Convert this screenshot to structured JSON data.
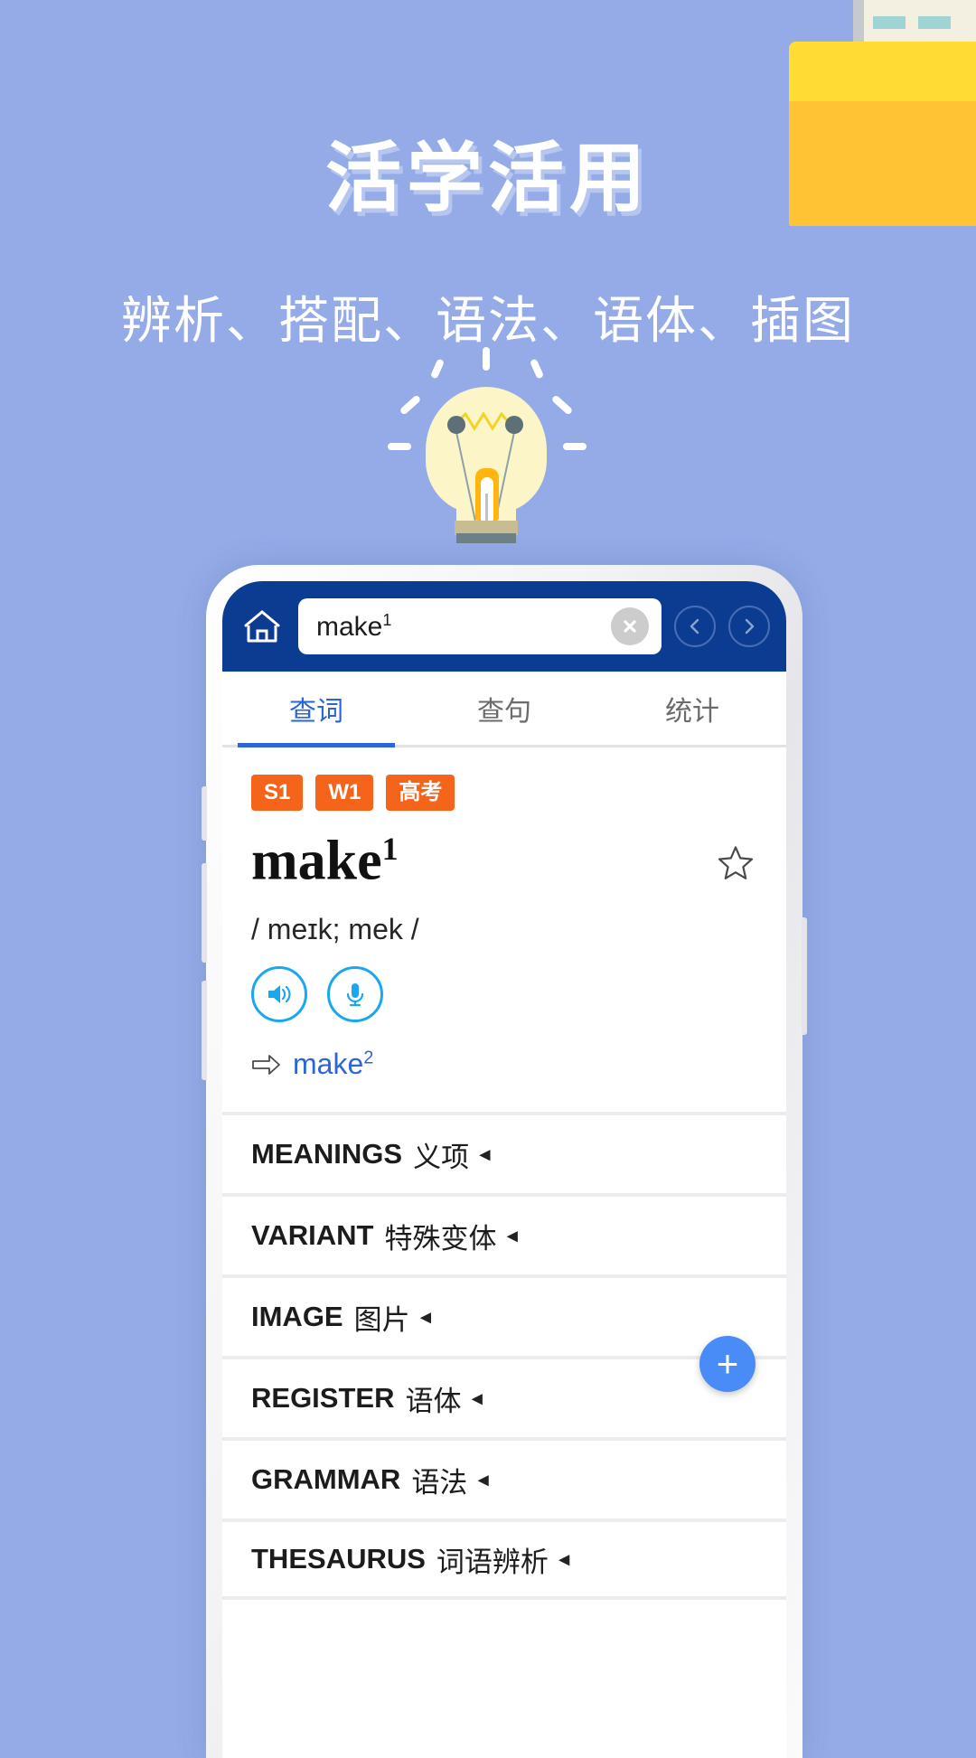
{
  "hero": {
    "title": "活学活用",
    "subtitle": "辨析、搭配、语法、语体、插图"
  },
  "colors": {
    "background": "#94abe8",
    "app_header": "#0c3c91",
    "accent_blue": "#2b66d9",
    "badge_orange": "#f4651b",
    "audio_cyan": "#19a8f0",
    "fab_blue": "#4a8cf7",
    "folder_front": "#ffc333",
    "folder_back": "#ffdd33"
  },
  "decor": {
    "folder_icon": "folder-icon",
    "document_icon": "document-icon",
    "bulb_icon": "lightbulb-icon"
  },
  "app": {
    "header": {
      "home_icon": "home-icon",
      "search_value": "make",
      "search_superscript": "1",
      "clear_icon": "clear-circle-icon",
      "back_icon": "chevron-left-icon",
      "forward_icon": "chevron-right-icon"
    },
    "tabs": [
      {
        "label": "查词",
        "active": true
      },
      {
        "label": "查句",
        "active": false
      },
      {
        "label": "统计",
        "active": false
      }
    ],
    "entry": {
      "badges": [
        "S1",
        "W1",
        "高考"
      ],
      "headword": "make",
      "headword_superscript": "1",
      "star_icon": "star-outline-icon",
      "phonetic": "/ meɪk; mek /",
      "speaker_icon": "speaker-icon",
      "mic_icon": "microphone-icon",
      "xref_arrow_icon": "arrow-right-icon",
      "xref_text": "make",
      "xref_superscript": "2"
    },
    "sections": [
      {
        "en": "MEANINGS",
        "cn": "义项",
        "caret": "◂"
      },
      {
        "en": "VARIANT",
        "cn": "特殊变体",
        "caret": "◂"
      },
      {
        "en": "IMAGE",
        "cn": "图片",
        "caret": "◂"
      },
      {
        "en": "REGISTER",
        "cn": "语体",
        "caret": "◂"
      },
      {
        "en": "GRAMMAR",
        "cn": "语法",
        "caret": "◂"
      },
      {
        "en": "THESAURUS",
        "cn": "词语辨析",
        "caret": "◂"
      }
    ],
    "fab_label": "+"
  }
}
